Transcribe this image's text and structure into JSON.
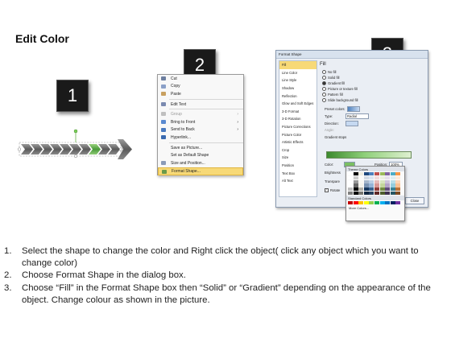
{
  "page": {
    "title": "Edit Color"
  },
  "steps": {
    "one": "1",
    "two": "2",
    "three": "3"
  },
  "context_menu": {
    "items": [
      {
        "label": "Cut",
        "disabled": false,
        "icon": "scissors-icon"
      },
      {
        "label": "Copy",
        "disabled": false,
        "icon": "copy-icon"
      },
      {
        "label": "Paste",
        "disabled": false,
        "icon": "paste-icon"
      },
      {
        "label": "Edit Text",
        "disabled": false,
        "icon": "edit-text-icon"
      },
      {
        "label": "Group",
        "disabled": true,
        "icon": "group-icon",
        "submenu": true
      },
      {
        "label": "Bring to Front",
        "disabled": false,
        "icon": "bring-front-icon",
        "submenu": true
      },
      {
        "label": "Send to Back",
        "disabled": false,
        "icon": "send-back-icon",
        "submenu": true
      },
      {
        "label": "Hyperlink...",
        "disabled": false,
        "icon": "hyperlink-icon"
      },
      {
        "label": "Save as Picture...",
        "disabled": false,
        "icon": ""
      },
      {
        "label": "Set as Default Shape",
        "disabled": false,
        "icon": ""
      },
      {
        "label": "Size and Position...",
        "disabled": false,
        "icon": "size-position-icon"
      },
      {
        "label": "Format Shape...",
        "disabled": false,
        "icon": "format-shape-icon",
        "selected": true
      }
    ]
  },
  "dialog": {
    "title": "Format Shape",
    "sidebar": [
      "Fill",
      "Line Color",
      "Line Style",
      "Shadow",
      "Reflection",
      "Glow and Soft Edges",
      "3-D Format",
      "3-D Rotation",
      "Picture Corrections",
      "Picture Color",
      "Artistic Effects",
      "Crop",
      "Size",
      "Position",
      "Text Box",
      "Alt Text"
    ],
    "section_title": "Fill",
    "fill_options": [
      "No fill",
      "Solid fill",
      "Gradient fill",
      "Picture or texture fill",
      "Pattern fill",
      "Slide background fill"
    ],
    "preset_colors": "Preset colors:",
    "type_label": "Type:",
    "type_value": "Radial",
    "direction_label": "Direction:",
    "angle_label": "Angle:",
    "gradient_stops": "Gradient stops",
    "color_label": "Color:",
    "position_label": "Position:",
    "position_value": "100%",
    "brightness_label": "Brightness",
    "transparency_label": "Transpare",
    "rotate_label": "Rotate",
    "close": "Close"
  },
  "palette": {
    "theme_header": "Theme Colors",
    "standard_header": "Standard Colors",
    "more": "More Colors...",
    "theme_top": [
      "#ffffff",
      "#000000",
      "#eeece1",
      "#1f497d",
      "#4f81bd",
      "#c0504d",
      "#9bbb59",
      "#8064a2",
      "#4bacc6",
      "#f79646"
    ],
    "standard": [
      "#c00000",
      "#ff0000",
      "#ffc000",
      "#ffff00",
      "#92d050",
      "#00b050",
      "#00b0f0",
      "#0070c0",
      "#002060",
      "#7030a0"
    ]
  },
  "instructions": [
    {
      "num": "1.",
      "text": "Select the shape to change the color and Right click the object( click any object which you want to change color)"
    },
    {
      "num": "2.",
      "text": "Choose Format Shape in the dialog box."
    },
    {
      "num": "3.",
      "text": "Choose “Fill” in the Format Shape box then “Solid” or “Gradient” depending on the appearance of the object. Change colour as shown in the picture."
    }
  ]
}
